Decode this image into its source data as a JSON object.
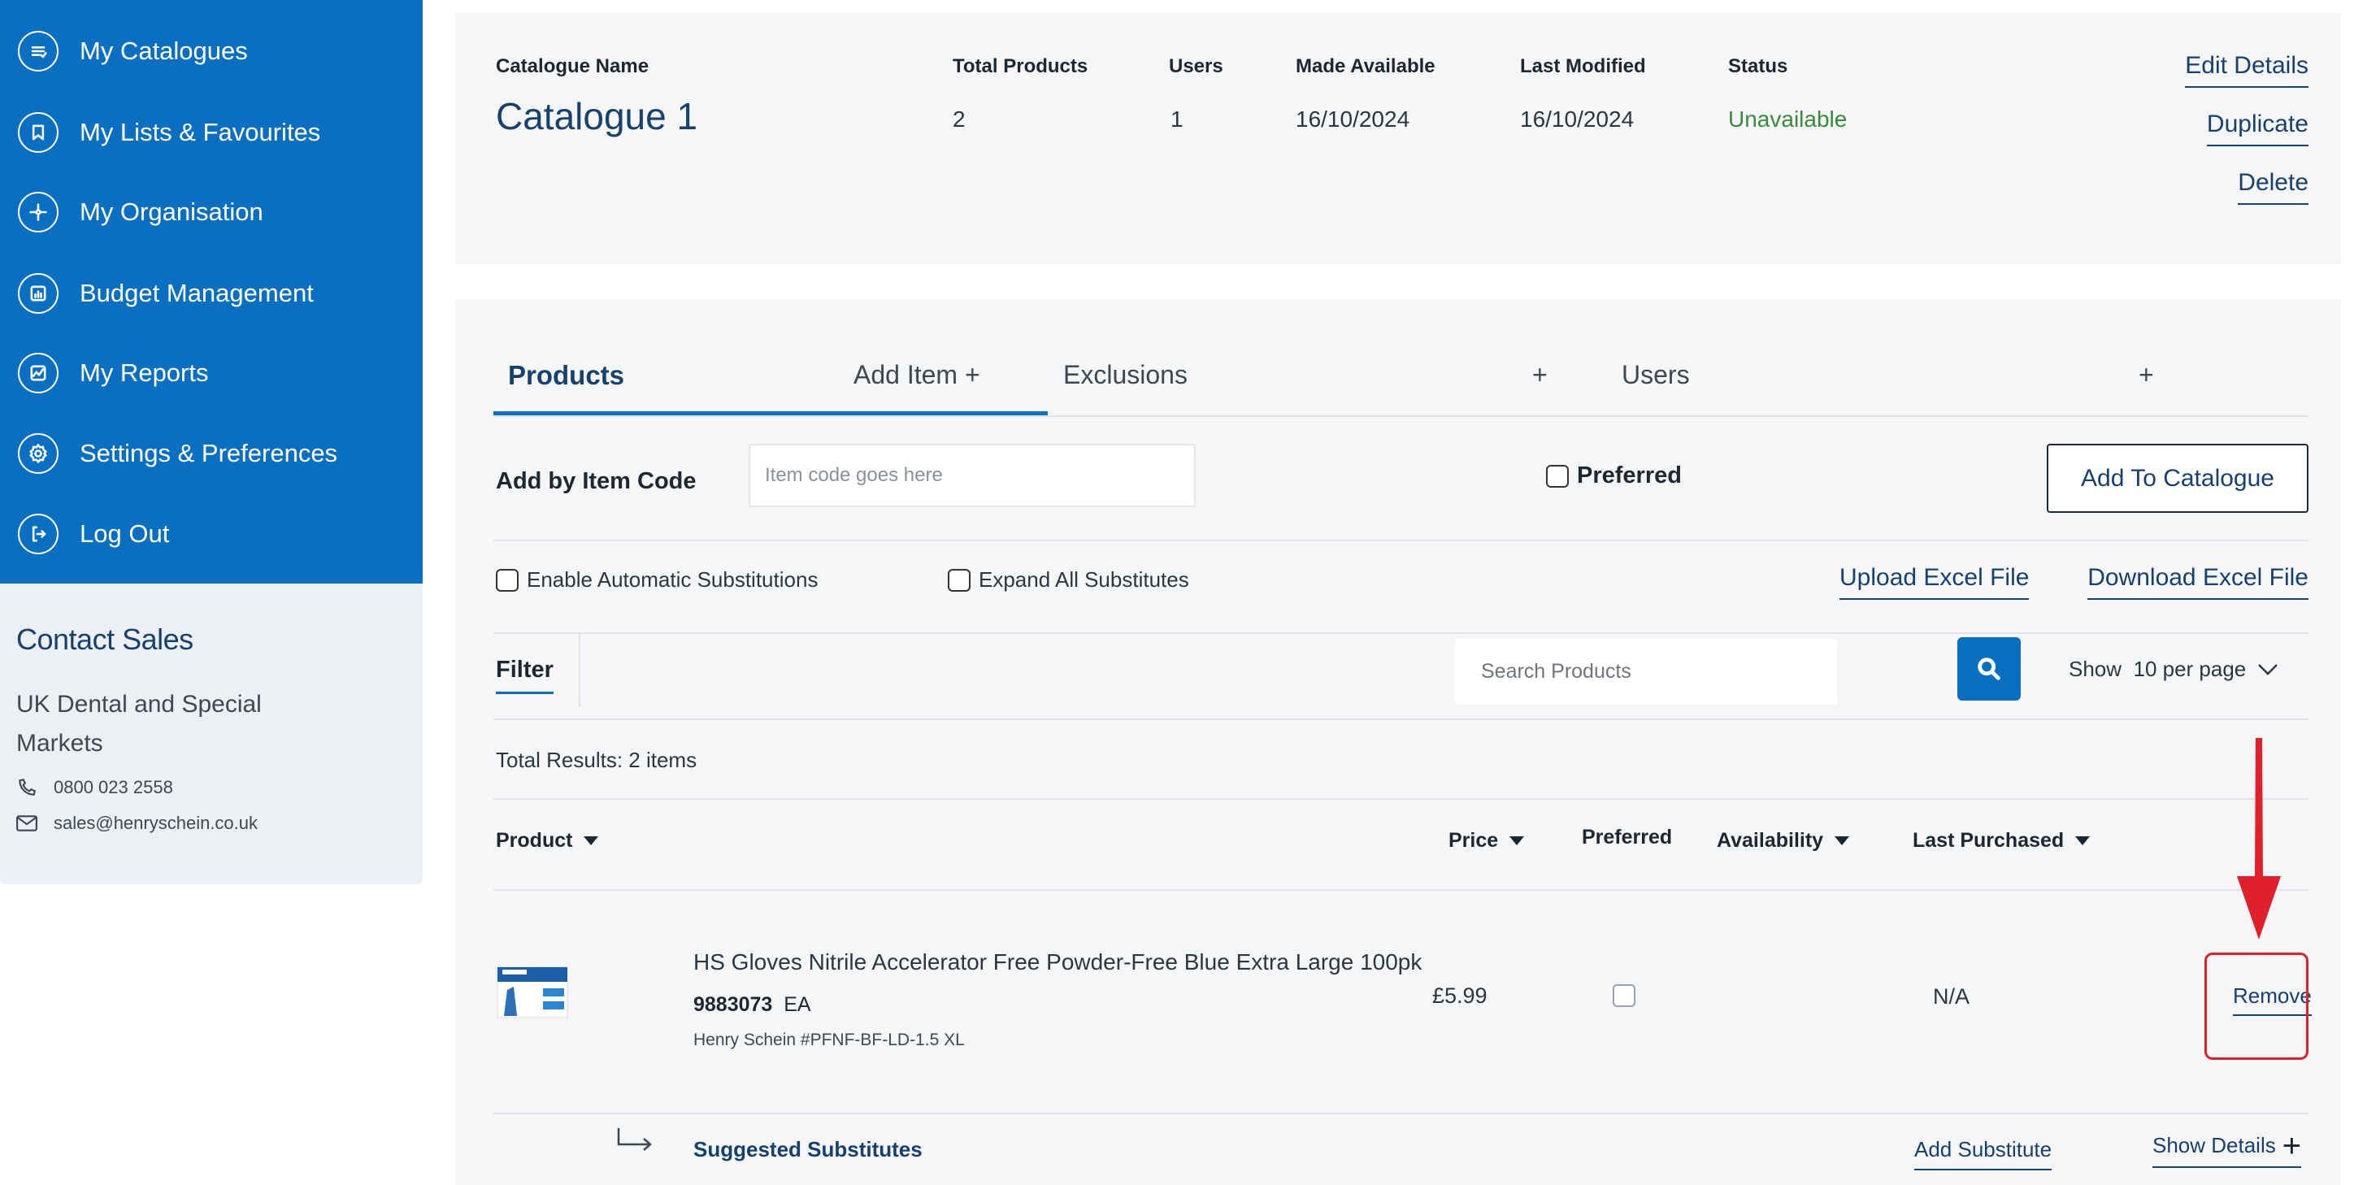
{
  "sidebar": {
    "items": [
      {
        "label": "My Catalogues",
        "icon": "catalogue-icon"
      },
      {
        "label": "My Lists & Favourites",
        "icon": "bookmark-icon"
      },
      {
        "label": "My Organisation",
        "icon": "organisation-icon"
      },
      {
        "label": "Budget Management",
        "icon": "budget-chart-icon"
      },
      {
        "label": "My Reports",
        "icon": "reports-icon"
      },
      {
        "label": "Settings & Preferences",
        "icon": "gear-icon"
      },
      {
        "label": "Log Out",
        "icon": "logout-icon"
      }
    ],
    "accent": "#0a6fc0"
  },
  "contact": {
    "title": "Contact Sales",
    "line1": "UK Dental and Special",
    "line2": "Markets",
    "phone": "0800 023 2558",
    "email": "sales@henryschein.co.uk"
  },
  "catalogue": {
    "headers": {
      "name": "Catalogue Name",
      "total_products": "Total Products",
      "users": "Users",
      "made_available": "Made Available",
      "last_modified": "Last Modified",
      "status": "Status"
    },
    "name": "Catalogue 1",
    "total_products": "2",
    "users": "1",
    "made_available": "16/10/2024",
    "last_modified": "16/10/2024",
    "status": "Unavailable",
    "status_color": "#3a8a3a",
    "actions": {
      "edit": "Edit Details",
      "duplicate": "Duplicate",
      "delete": "Delete"
    }
  },
  "tabs": {
    "products": "Products",
    "add_item": "Add Item +",
    "exclusions": "Exclusions",
    "exclusions_plus": "+",
    "users": "Users",
    "users_plus": "+"
  },
  "add_by_code": {
    "label": "Add by Item Code",
    "placeholder": "Item code goes here",
    "preferred_label": "Preferred",
    "button": "Add To Catalogue"
  },
  "options": {
    "auto_substitutions": "Enable Automatic Substitutions",
    "expand_substitutes": "Expand All Substitutes",
    "upload": "Upload Excel File",
    "download": "Download Excel File"
  },
  "filter_bar": {
    "filter": "Filter",
    "search_placeholder": "Search Products",
    "per_page": "Show  10 per page"
  },
  "results": {
    "total": "Total Results: 2 items"
  },
  "table": {
    "columns": {
      "product": "Product",
      "price": "Price",
      "preferred": "Preferred",
      "availability": "Availability",
      "last_purchased": "Last Purchased"
    },
    "rows": [
      {
        "name": "HS Gloves Nitrile Accelerator Free Powder-Free Blue Extra Large 100pk",
        "code": "9883073",
        "unit": "EA",
        "brand": "Henry Schein #PFNF-BF-LD-1.5 XL",
        "price": "£5.99",
        "preferred": false,
        "last_purchased": "N/A",
        "action": "Remove"
      }
    ]
  },
  "substitutes": {
    "label": "Suggested Substitutes",
    "add": "Add Substitute",
    "show_details": "Show Details"
  },
  "annotation": {
    "color": "#e0212b"
  }
}
